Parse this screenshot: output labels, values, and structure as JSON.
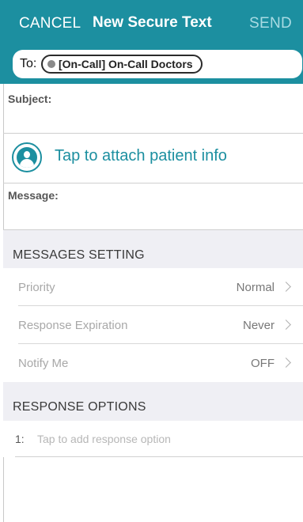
{
  "header": {
    "cancel_label": "CANCEL",
    "title": "New Secure Text",
    "send_label": "SEND"
  },
  "to_field": {
    "label": "To:",
    "recipient": "[On-Call] On-Call Doctors"
  },
  "subject": {
    "label": "Subject:"
  },
  "attach": {
    "icon": "patient-icon",
    "label": "Tap to attach patient info"
  },
  "message": {
    "label": "Message:"
  },
  "messages_setting": {
    "title": "MESSAGES SETTING",
    "rows": [
      {
        "label": "Priority",
        "value": "Normal"
      },
      {
        "label": "Response Expiration",
        "value": "Never"
      },
      {
        "label": "Notify Me",
        "value": "OFF"
      }
    ]
  },
  "response_options": {
    "title": "RESPONSE OPTIONS",
    "items": [
      {
        "number": "1:",
        "placeholder": "Tap to add response option"
      }
    ]
  },
  "colors": {
    "accent": "#1c8fa0",
    "send_disabled": "#a9dbe3",
    "section_background": "#efeff4"
  }
}
